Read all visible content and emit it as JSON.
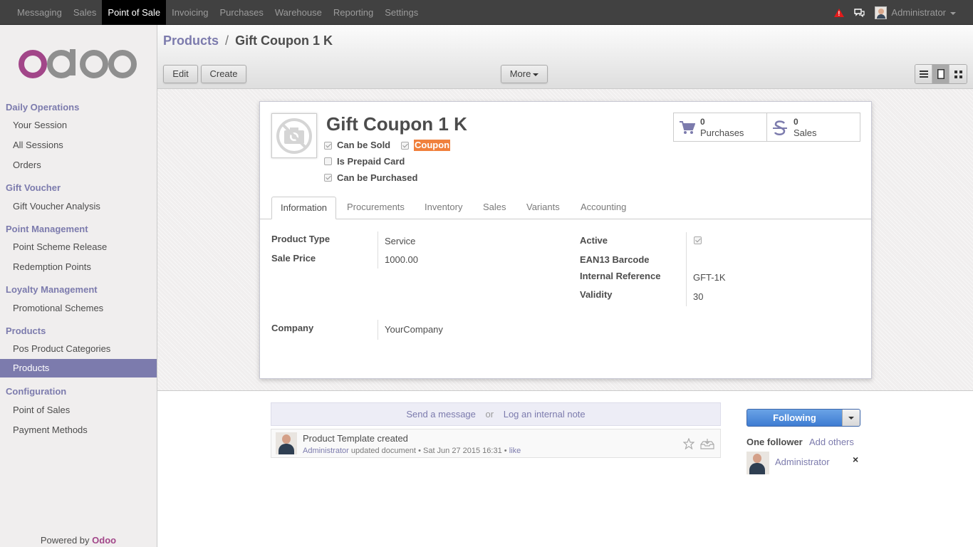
{
  "topbar": {
    "menu": [
      "Messaging",
      "Sales",
      "Point of Sale",
      "Invoicing",
      "Purchases",
      "Warehouse",
      "Reporting",
      "Settings"
    ],
    "active_menu": "Point of Sale",
    "user": "Administrator",
    "icons": [
      "warning-icon",
      "chat-icon",
      "avatar"
    ]
  },
  "sidebar": {
    "sections": [
      {
        "title": "Daily Operations",
        "items": [
          "Your Session",
          "All Sessions",
          "Orders"
        ]
      },
      {
        "title": "Gift Voucher",
        "items": [
          "Gift Voucher Analysis"
        ]
      },
      {
        "title": "Point Management",
        "items": [
          "Point Scheme Release",
          "Redemption Points"
        ]
      },
      {
        "title": "Loyalty Management",
        "items": [
          "Promotional Schemes"
        ]
      },
      {
        "title": "Products",
        "items": [
          "Pos Product Categories",
          "Products"
        ]
      },
      {
        "title": "Configuration",
        "items": [
          "Point of Sales",
          "Payment Methods"
        ]
      }
    ],
    "active_item": "Products",
    "powered_by": "Powered by",
    "powered_brand": "Odoo"
  },
  "control_panel": {
    "breadcrumb_parent": "Products",
    "breadcrumb_sep": "/",
    "breadcrumb_current": "Gift Coupon 1 K",
    "edit_label": "Edit",
    "create_label": "Create",
    "more_label": "More"
  },
  "form": {
    "title": "Gift Coupon 1 K",
    "checkboxes": {
      "can_be_sold": {
        "label": "Can be Sold",
        "checked": true
      },
      "coupon": {
        "label": "Coupon",
        "checked": true
      },
      "prepaid": {
        "label": "Is Prepaid Card",
        "checked": false
      },
      "purchased": {
        "label": "Can be Purchased",
        "checked": true
      }
    },
    "stats": {
      "purchases_count": "0",
      "purchases_label": "Purchases",
      "sales_count": "0",
      "sales_label": "Sales"
    },
    "tabs": [
      "Information",
      "Procurements",
      "Inventory",
      "Sales",
      "Variants",
      "Accounting"
    ],
    "active_tab": "Information",
    "fields": {
      "product_type_label": "Product Type",
      "product_type_value": "Service",
      "sale_price_label": "Sale Price",
      "sale_price_value": "1000.00",
      "company_label": "Company",
      "company_value": "YourCompany",
      "active_label": "Active",
      "active_checked": true,
      "ean13_label": "EAN13 Barcode",
      "ean13_value": "",
      "internal_ref_label": "Internal Reference",
      "internal_ref_value": "GFT-1K",
      "validity_label": "Validity",
      "validity_value": "30"
    }
  },
  "chatter": {
    "send_message": "Send a message",
    "or": "or",
    "log_note": "Log an internal note",
    "message": {
      "title": "Product Template created",
      "author": "Administrator",
      "action": "updated document",
      "dot": "•",
      "date": "Sat Jun 27 2015 16:31",
      "like": "like"
    },
    "following_label": "Following",
    "followers_label": "One follower",
    "add_others": "Add others",
    "follower_name": "Administrator",
    "remove_symbol": "×"
  },
  "colors": {
    "accent": "#7c7bad",
    "topbar": "#414141",
    "coupon_highlight": "#f0803c",
    "follow_button": "#3e7cd2",
    "brand": "#a24689"
  }
}
